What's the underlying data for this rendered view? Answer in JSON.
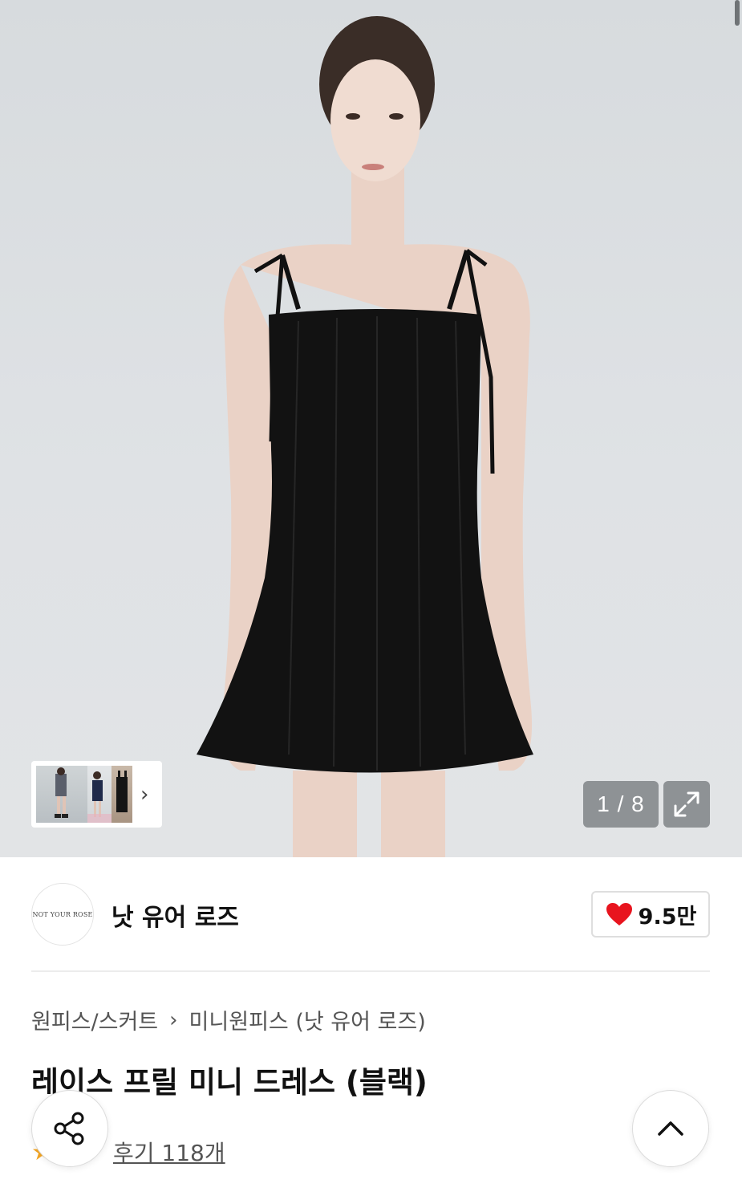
{
  "gallery": {
    "counter": "1 / 8",
    "thumbnail_next": "›"
  },
  "brand": {
    "logo_text": "NOT YOUR ROSE",
    "name": "낫 유어 로즈",
    "like_count": "9.5만"
  },
  "breadcrumb": {
    "category": "원피스/스커트",
    "separator": "›",
    "subcategory": "미니원피스 (낫 유어 로즈)"
  },
  "product": {
    "title": "레이스 프릴 미니 드레스 (블랙)",
    "reviews": "후기 118개"
  },
  "colors": {
    "heart": "#e8141e",
    "star": "#f5a623"
  },
  "icons": {
    "expand": "expand-icon",
    "share": "share-icon",
    "scroll_top": "chevron-up-icon"
  }
}
